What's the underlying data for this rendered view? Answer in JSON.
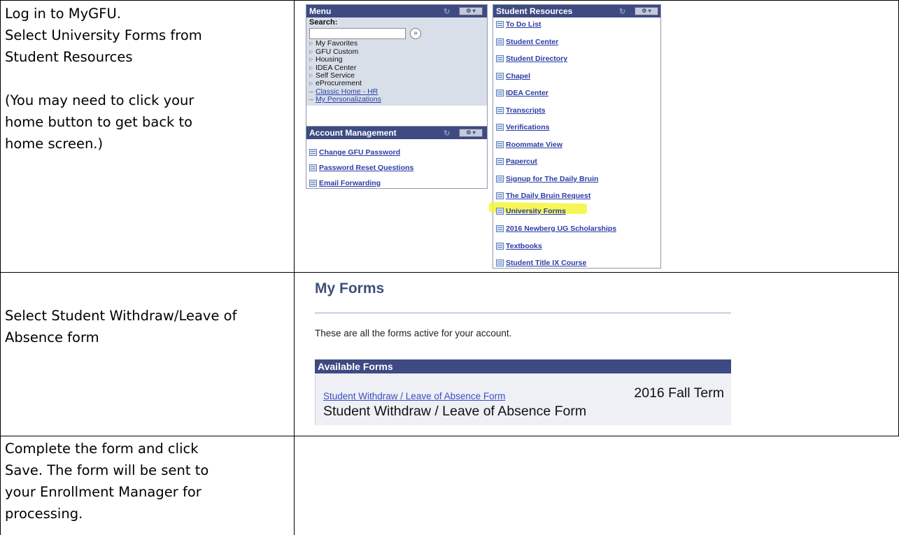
{
  "steps": [
    {
      "lines": [
        "Log in to MyGFU.",
        "Select University Forms from Student Resources"
      ],
      "note": "(You may need to click your home button to get back to home screen.)"
    },
    {
      "text": "Select Student Withdraw/Leave of Absence form"
    },
    {
      "text": "Complete the form and click Save. The form will be sent to your Enrollment Manager for processing."
    }
  ],
  "portal": {
    "menu": {
      "title": "Menu",
      "search_label": "Search:",
      "items": [
        "My Favorites",
        "GFU Custom",
        "Housing",
        "IDEA Center",
        "Self Service",
        "eProcurement"
      ],
      "links": [
        "Classic Home - HR",
        "My Personalizations"
      ]
    },
    "account_management": {
      "title": "Account Management",
      "links": [
        "Change GFU Password",
        "Password Reset Questions",
        "Email Forwarding"
      ]
    },
    "student_resources": {
      "title": "Student Resources",
      "links": [
        "To Do List",
        "Student Center",
        "Student Directory",
        "Chapel",
        "IDEA Center",
        "Transcripts",
        "Verifications",
        "Roommate View",
        "Papercut",
        "Signup for The Daily Bruin",
        "The Daily Bruin Request",
        "University Forms",
        "2016 Newberg UG Scholarships",
        "Textbooks",
        "Student Title IX Course"
      ],
      "highlighted": "University Forms",
      "highlight_color": "#f5f53a"
    },
    "header_color": "#3e4a82"
  },
  "my_forms": {
    "title": "My Forms",
    "description": "These are all the forms active for your account.",
    "section_header": "Available Forms",
    "form": {
      "link": "Student Withdraw / Leave of Absence Form",
      "term": "2016 Fall Term",
      "name": "Student Withdraw / Leave of Absence Form"
    }
  }
}
